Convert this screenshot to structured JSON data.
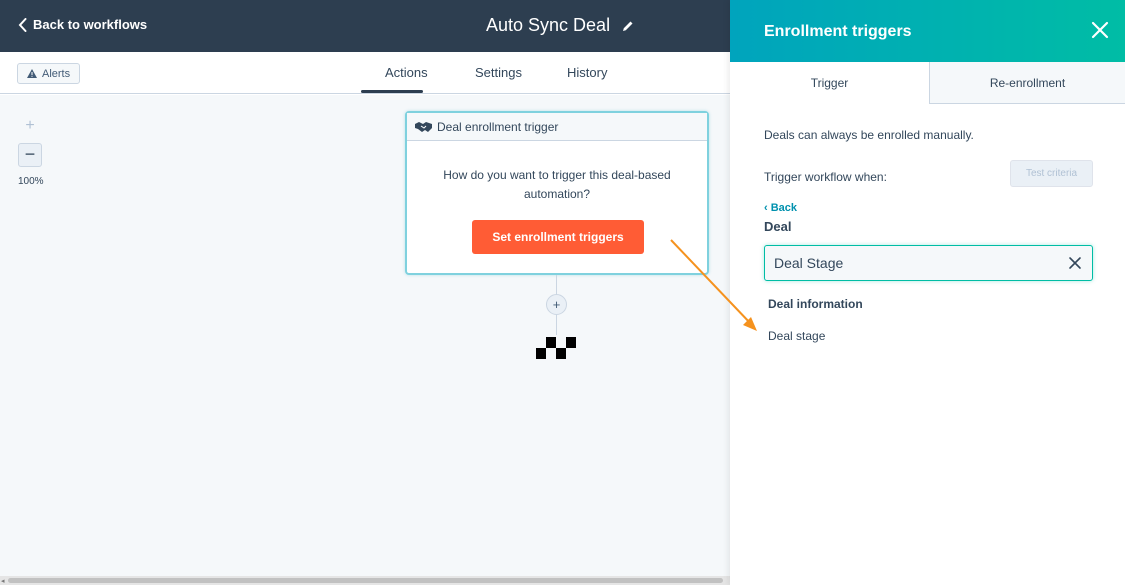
{
  "topbar": {
    "back_label": "Back to workflows",
    "workflow_title": "Auto Sync Deal",
    "bg_color": "#2d3e50"
  },
  "subbar": {
    "alerts_label": "Alerts",
    "tabs": [
      {
        "label": "Actions",
        "active": true
      },
      {
        "label": "Settings",
        "active": false
      },
      {
        "label": "History",
        "active": false
      }
    ]
  },
  "canvas": {
    "zoom_in": "+",
    "zoom_out": "−",
    "zoom_level": "100%",
    "trigger_card": {
      "header": "Deal enrollment trigger",
      "question": "How do you want to trigger this deal-based automation?",
      "button_label": "Set enrollment triggers",
      "button_color": "#ff5c35"
    },
    "add_step": "+"
  },
  "panel": {
    "title": "Enrollment triggers",
    "tabs": [
      {
        "label": "Trigger",
        "active": true
      },
      {
        "label": "Re-enrollment",
        "active": false
      }
    ],
    "manual_note": "Deals can always be enrolled manually.",
    "trigger_when_label": "Trigger workflow when:",
    "test_criteria_label": "Test criteria",
    "back_label": "‹ Back",
    "object_label": "Deal",
    "search": {
      "value": "Deal Stage",
      "placeholder": ""
    },
    "group_heading": "Deal information",
    "options": [
      "Deal stage"
    ],
    "header_gradient": [
      "#00a4bd",
      "#00bda5"
    ]
  },
  "annotation": {
    "arrow_color": "#f5921e"
  }
}
